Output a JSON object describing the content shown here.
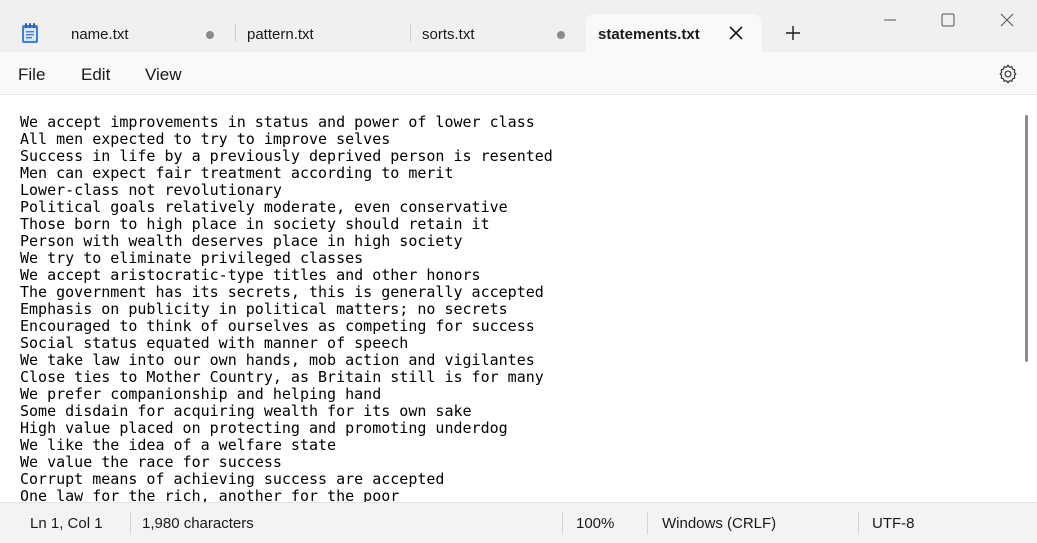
{
  "tabs": [
    {
      "label": "name.txt",
      "modified": true,
      "active": false
    },
    {
      "label": "pattern.txt",
      "modified": false,
      "active": false
    },
    {
      "label": "sorts.txt",
      "modified": true,
      "active": false
    },
    {
      "label": "statements.txt",
      "modified": false,
      "active": true
    }
  ],
  "menu": {
    "file": "File",
    "edit": "Edit",
    "view": "View"
  },
  "icons": {
    "app": "notepad-icon",
    "close_tab": "close-icon",
    "new_tab": "plus-icon",
    "minimize": "minimize-icon",
    "maximize": "maximize-icon",
    "close_window": "close-icon",
    "settings": "gear-icon"
  },
  "document": {
    "lines": [
      "We accept improvements in status and power of lower class",
      "All men expected to try to improve selves",
      "Success in life by a previously deprived person is resented",
      "Men can expect fair treatment according to merit",
      "Lower-class not revolutionary",
      "Political goals relatively moderate, even conservative",
      "Those born to high place in society should retain it",
      "Person with wealth deserves place in high society",
      "We try to eliminate privileged classes",
      "We accept aristocratic-type titles and other honors",
      "The government has its secrets, this is generally accepted",
      "Emphasis on publicity in political matters; no secrets",
      "Encouraged to think of ourselves as competing for success",
      "Social status equated with manner of speech",
      "We take law into our own hands, mob action and vigilantes",
      "Close ties to Mother Country, as Britain still is for many",
      "We prefer companionship and helping hand",
      "Some disdain for acquiring wealth for its own sake",
      "High value placed on protecting and promoting underdog",
      "We like the idea of a welfare state",
      "We value the race for success",
      "Corrupt means of achieving success are accepted",
      "One law for the rich, another for the poor"
    ]
  },
  "status": {
    "position": "Ln 1, Col 1",
    "characters": "1,980 characters",
    "zoom": "100%",
    "line_ending": "Windows (CRLF)",
    "encoding": "UTF-8"
  },
  "colors": {
    "modified_dot": "#8a8a8a",
    "notepad_blue": "#3f7fd6"
  }
}
